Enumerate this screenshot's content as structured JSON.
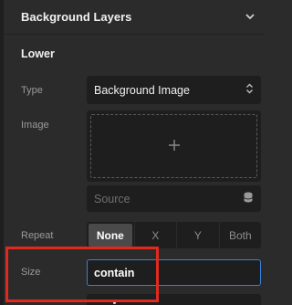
{
  "header": {
    "title": "Background Layers",
    "chevron_icon": "chevron-down-icon"
  },
  "layer": {
    "title": "Lower",
    "type": {
      "label": "Type",
      "value": "Background Image",
      "icon": "up-down-arrows-icon"
    },
    "image": {
      "label": "Image",
      "add_icon": "plus-icon"
    },
    "source": {
      "placeholder": "Source",
      "icon": "database-icon"
    },
    "repeat": {
      "label": "Repeat",
      "options": [
        "None",
        "X",
        "Y",
        "Both"
      ],
      "selected": "None"
    },
    "size": {
      "label": "Size",
      "value": "contain"
    }
  },
  "colors": {
    "background": "#2b2b2b",
    "field": "#1e1e1e",
    "focus_border": "#3b7fd9",
    "highlight": "#e02a1f"
  }
}
